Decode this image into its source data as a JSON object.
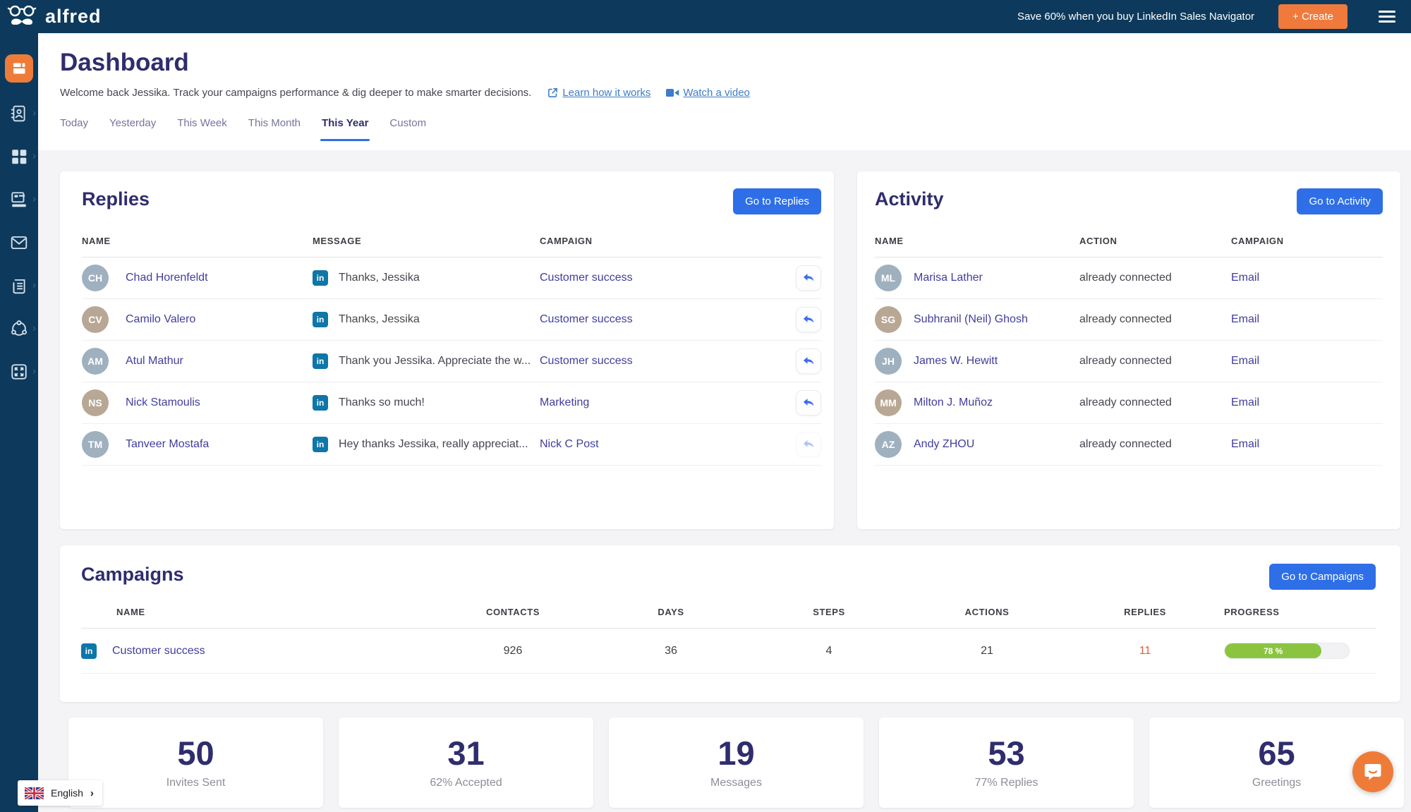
{
  "topbar": {
    "brand": "alfred",
    "promo": "Save 60% when you buy LinkedIn Sales Navigator",
    "create_label": "+ Create"
  },
  "header": {
    "title": "Dashboard",
    "welcome": "Welcome back Jessika. Track your campaigns performance & dig deeper to make smarter decisions.",
    "learn_link": "Learn how it works",
    "watch_link": "Watch a video"
  },
  "tabs": {
    "active": "This Year",
    "items": [
      {
        "label": "Today"
      },
      {
        "label": "Yesterday"
      },
      {
        "label": "This Week"
      },
      {
        "label": "This Month"
      },
      {
        "label": "This Year"
      },
      {
        "label": "Custom"
      }
    ]
  },
  "replies": {
    "title": "Replies",
    "button": "Go to Replies",
    "columns": [
      "NAME",
      "MESSAGE",
      "CAMPAIGN"
    ],
    "rows": [
      {
        "name": "Chad Horenfeldt",
        "message": "Thanks, Jessika",
        "campaign": "Customer success"
      },
      {
        "name": "Camilo Valero",
        "message": "Thanks, Jessika",
        "campaign": "Customer success"
      },
      {
        "name": "Atul Mathur",
        "message": "Thank you Jessika. Appreciate the w...",
        "campaign": "Customer success"
      },
      {
        "name": "Nick Stamoulis",
        "message": "Thanks so much!",
        "campaign": "Marketing"
      },
      {
        "name": "Tanveer Mostafa",
        "message": "Hey thanks Jessika, really appreciat...",
        "campaign": "Nick C Post"
      }
    ]
  },
  "activity": {
    "title": "Activity",
    "button": "Go to Activity",
    "columns": [
      "NAME",
      "ACTION",
      "CAMPAIGN"
    ],
    "rows": [
      {
        "name": "Marisa Lather",
        "action": "already connected",
        "campaign": "Email"
      },
      {
        "name": "Subhranil (Neil) Ghosh",
        "action": "already connected",
        "campaign": "Email"
      },
      {
        "name": "James W. Hewitt",
        "action": "already connected",
        "campaign": "Email"
      },
      {
        "name": "Milton J. Muñoz",
        "action": "already connected",
        "campaign": "Email"
      },
      {
        "name": "Andy ZHOU",
        "action": "already connected",
        "campaign": "Email"
      }
    ]
  },
  "campaigns": {
    "title": "Campaigns",
    "button": "Go to Campaigns",
    "columns": [
      "NAME",
      "CONTACTS",
      "DAYS",
      "STEPS",
      "ACTIONS",
      "REPLIES",
      "PROGRESS"
    ],
    "rows": [
      {
        "name": "Customer success",
        "contacts": "926",
        "days": "36",
        "steps": "4",
        "actions": "21",
        "replies": "11",
        "progress_label": "78 %",
        "progress_pct": 78
      }
    ]
  },
  "stats": [
    {
      "value": "50",
      "label": "Invites Sent"
    },
    {
      "value": "31",
      "label": "62% Accepted"
    },
    {
      "value": "19",
      "label": "Messages"
    },
    {
      "value": "53",
      "label": "77% Replies"
    },
    {
      "value": "65",
      "label": "Greetings"
    }
  ],
  "language": {
    "label": "English"
  },
  "icons": {
    "sidebar": [
      "dashboard-icon",
      "contacts-icon",
      "campaigns-icon",
      "templates-icon",
      "inbox-icon",
      "feed-icon",
      "network-icon",
      "integrations-icon"
    ],
    "other": [
      "hamburger-menu-icon",
      "external-link-icon",
      "video-camera-icon",
      "linkedin-icon",
      "reply-arrow-icon",
      "uk-flag-icon",
      "chat-bubble-icon"
    ]
  },
  "colors": {
    "navy": "#0d3a5c",
    "orange": "#ee7c38",
    "blue": "#2e6fe8",
    "link_blue": "#3b7dc8",
    "indigo": "#2f2d6d",
    "green": "#8bc540",
    "red": "#e85c41",
    "linkedin": "#0e76a8"
  }
}
